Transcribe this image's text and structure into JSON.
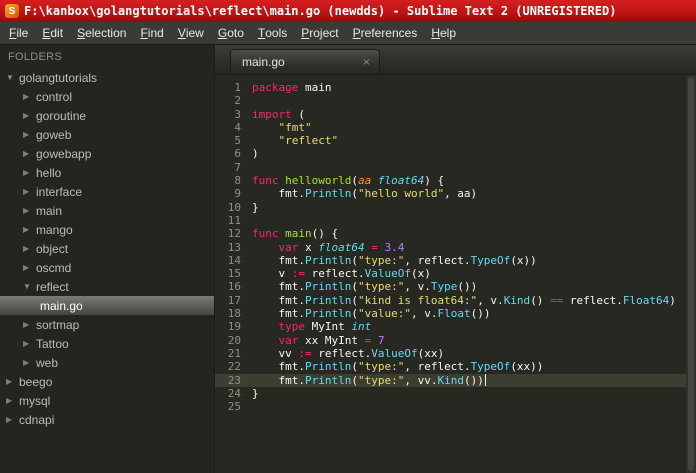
{
  "window": {
    "title": "F:\\kanbox\\golangtutorials\\reflect\\main.go (newdds) - Sublime Text 2 (UNREGISTERED)",
    "icon_letter": "S"
  },
  "menu": {
    "items": [
      "File",
      "Edit",
      "Selection",
      "Find",
      "View",
      "Goto",
      "Tools",
      "Project",
      "Preferences",
      "Help"
    ]
  },
  "sidebar": {
    "header": "FOLDERS",
    "arrow_expanded": "▼",
    "arrow_collapsed": "▶",
    "tree": [
      {
        "label": "golangtutorials",
        "kind": "folder",
        "state": "expanded",
        "depth": 0
      },
      {
        "label": "control",
        "kind": "folder",
        "state": "collapsed",
        "depth": 1
      },
      {
        "label": "goroutine",
        "kind": "folder",
        "state": "collapsed",
        "depth": 1
      },
      {
        "label": "goweb",
        "kind": "folder",
        "state": "collapsed",
        "depth": 1
      },
      {
        "label": "gowebapp",
        "kind": "folder",
        "state": "collapsed",
        "depth": 1
      },
      {
        "label": "hello",
        "kind": "folder",
        "state": "collapsed",
        "depth": 1
      },
      {
        "label": "interface",
        "kind": "folder",
        "state": "collapsed",
        "depth": 1
      },
      {
        "label": "main",
        "kind": "folder",
        "state": "collapsed",
        "depth": 1
      },
      {
        "label": "mango",
        "kind": "folder",
        "state": "collapsed",
        "depth": 1
      },
      {
        "label": "object",
        "kind": "folder",
        "state": "collapsed",
        "depth": 1
      },
      {
        "label": "oscmd",
        "kind": "folder",
        "state": "collapsed",
        "depth": 1
      },
      {
        "label": "reflect",
        "kind": "folder",
        "state": "expanded",
        "depth": 1
      },
      {
        "label": "main.go",
        "kind": "file",
        "state": "selected",
        "depth": 2
      },
      {
        "label": "sortmap",
        "kind": "folder",
        "state": "collapsed",
        "depth": 1
      },
      {
        "label": "Tattoo",
        "kind": "folder",
        "state": "collapsed",
        "depth": 1
      },
      {
        "label": "web",
        "kind": "folder",
        "state": "collapsed",
        "depth": 1
      },
      {
        "label": "beego",
        "kind": "folder",
        "state": "collapsed",
        "depth": 0
      },
      {
        "label": "mysql",
        "kind": "folder",
        "state": "collapsed",
        "depth": 0
      },
      {
        "label": "cdnapi",
        "kind": "folder",
        "state": "collapsed",
        "depth": 0
      }
    ]
  },
  "tabs": [
    {
      "label": "main.go",
      "active": true,
      "close_glyph": "×"
    }
  ],
  "editor": {
    "current_line": 23,
    "cursor_line": 23,
    "lines": [
      {
        "n": 1,
        "tokens": [
          [
            "kw",
            "package"
          ],
          [
            "pl",
            " main"
          ]
        ]
      },
      {
        "n": 2,
        "tokens": []
      },
      {
        "n": 3,
        "tokens": [
          [
            "kw",
            "import"
          ],
          [
            "pl",
            " ("
          ]
        ]
      },
      {
        "n": 4,
        "tokens": [
          [
            "pl",
            "    "
          ],
          [
            "str",
            "\"fmt\""
          ]
        ]
      },
      {
        "n": 5,
        "tokens": [
          [
            "pl",
            "    "
          ],
          [
            "str",
            "\"reflect\""
          ]
        ]
      },
      {
        "n": 6,
        "tokens": [
          [
            "pl",
            ")"
          ]
        ]
      },
      {
        "n": 7,
        "tokens": []
      },
      {
        "n": 8,
        "tokens": [
          [
            "kw",
            "func"
          ],
          [
            "pl",
            " "
          ],
          [
            "fn",
            "helloworld"
          ],
          [
            "pl",
            "("
          ],
          [
            "par",
            "aa"
          ],
          [
            "pl",
            " "
          ],
          [
            "ty",
            "float64"
          ],
          [
            "pl",
            ") {"
          ]
        ]
      },
      {
        "n": 9,
        "tokens": [
          [
            "pl",
            "    fmt."
          ],
          [
            "lib",
            "Println"
          ],
          [
            "pl",
            "("
          ],
          [
            "str",
            "\"hello world\""
          ],
          [
            "pl",
            ", aa)"
          ]
        ]
      },
      {
        "n": 10,
        "tokens": [
          [
            "pl",
            "}"
          ]
        ]
      },
      {
        "n": 11,
        "tokens": []
      },
      {
        "n": 12,
        "tokens": [
          [
            "kw",
            "func"
          ],
          [
            "pl",
            " "
          ],
          [
            "fn",
            "main"
          ],
          [
            "pl",
            "() {"
          ]
        ]
      },
      {
        "n": 13,
        "tokens": [
          [
            "pl",
            "    "
          ],
          [
            "kw",
            "var"
          ],
          [
            "pl",
            " x "
          ],
          [
            "ty",
            "float64"
          ],
          [
            "pl",
            " "
          ],
          [
            "kw",
            "="
          ],
          [
            "pl",
            " "
          ],
          [
            "num",
            "3.4"
          ]
        ]
      },
      {
        "n": 14,
        "tokens": [
          [
            "pl",
            "    fmt."
          ],
          [
            "lib",
            "Println"
          ],
          [
            "pl",
            "("
          ],
          [
            "str",
            "\"type:\""
          ],
          [
            "pl",
            ", reflect."
          ],
          [
            "lib",
            "TypeOf"
          ],
          [
            "pl",
            "(x))"
          ]
        ]
      },
      {
        "n": 15,
        "tokens": [
          [
            "pl",
            "    v "
          ],
          [
            "kw",
            ":="
          ],
          [
            "pl",
            " reflect."
          ],
          [
            "lib",
            "ValueOf"
          ],
          [
            "pl",
            "(x)"
          ]
        ]
      },
      {
        "n": 16,
        "tokens": [
          [
            "pl",
            "    fmt."
          ],
          [
            "lib",
            "Println"
          ],
          [
            "pl",
            "("
          ],
          [
            "str",
            "\"type:\""
          ],
          [
            "pl",
            ", v."
          ],
          [
            "lib",
            "Type"
          ],
          [
            "pl",
            "())"
          ]
        ]
      },
      {
        "n": 17,
        "tokens": [
          [
            "pl",
            "    fmt."
          ],
          [
            "lib",
            "Println"
          ],
          [
            "pl",
            "("
          ],
          [
            "str",
            "\"kind is float64:\""
          ],
          [
            "pl",
            ", v."
          ],
          [
            "lib",
            "Kind"
          ],
          [
            "pl",
            "() "
          ],
          [
            "kw",
            "=="
          ],
          [
            "pl",
            " reflect."
          ],
          [
            "lib",
            "Float64"
          ],
          [
            "pl",
            ")"
          ]
        ]
      },
      {
        "n": 18,
        "tokens": [
          [
            "pl",
            "    fmt."
          ],
          [
            "lib",
            "Println"
          ],
          [
            "pl",
            "("
          ],
          [
            "str",
            "\"value:\""
          ],
          [
            "pl",
            ", v."
          ],
          [
            "lib",
            "Float"
          ],
          [
            "pl",
            "())"
          ]
        ]
      },
      {
        "n": 19,
        "tokens": [
          [
            "pl",
            "    "
          ],
          [
            "kw",
            "type"
          ],
          [
            "pl",
            " MyInt "
          ],
          [
            "ty",
            "int"
          ]
        ]
      },
      {
        "n": 20,
        "tokens": [
          [
            "pl",
            "    "
          ],
          [
            "kw",
            "var"
          ],
          [
            "pl",
            " xx MyInt "
          ],
          [
            "kw",
            "="
          ],
          [
            "pl",
            " "
          ],
          [
            "num",
            "7"
          ]
        ]
      },
      {
        "n": 21,
        "tokens": [
          [
            "pl",
            "    vv "
          ],
          [
            "kw",
            ":="
          ],
          [
            "pl",
            " reflect."
          ],
          [
            "lib",
            "ValueOf"
          ],
          [
            "pl",
            "(xx)"
          ]
        ]
      },
      {
        "n": 22,
        "tokens": [
          [
            "pl",
            "    fmt."
          ],
          [
            "lib",
            "Println"
          ],
          [
            "pl",
            "("
          ],
          [
            "str",
            "\"type:\""
          ],
          [
            "pl",
            ", reflect."
          ],
          [
            "lib",
            "TypeOf"
          ],
          [
            "pl",
            "(xx))"
          ]
        ]
      },
      {
        "n": 23,
        "tokens": [
          [
            "pl",
            "    fmt."
          ],
          [
            "lib",
            "Println"
          ],
          [
            "pl",
            "("
          ],
          [
            "str",
            "\"type:\""
          ],
          [
            "pl",
            ", vv."
          ],
          [
            "lib",
            "Kind"
          ],
          [
            "pl",
            "())"
          ]
        ]
      },
      {
        "n": 24,
        "tokens": [
          [
            "pl",
            "}"
          ]
        ]
      },
      {
        "n": 25,
        "tokens": []
      }
    ]
  },
  "colors": {
    "keyword": "#f92672",
    "string": "#e6db74",
    "function_name": "#a6e22e",
    "type_name": "#66d9ef",
    "library_call": "#66d9ef",
    "number": "#ae81ff",
    "parameter": "#fd971f",
    "plain_text": "#f8f8f2",
    "editor_background": "#272822",
    "current_line_highlight": "#3e3d32",
    "line_number": "#8f908a",
    "title_bar": "#c01414"
  }
}
